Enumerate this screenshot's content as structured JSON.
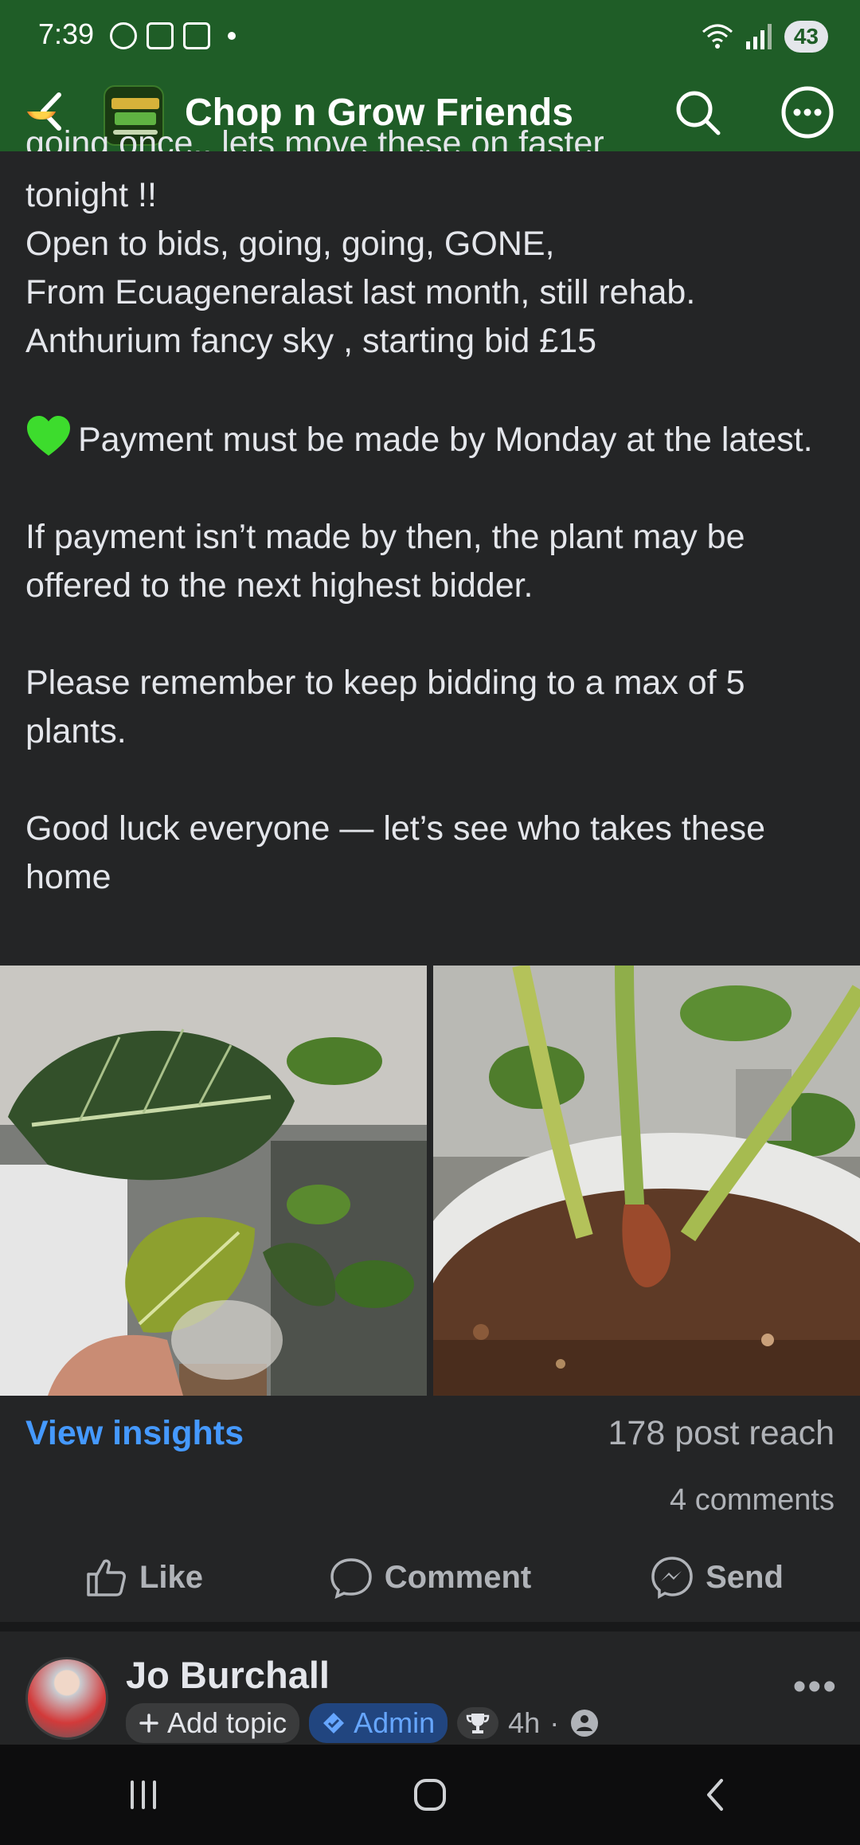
{
  "status_bar": {
    "time": "7:39",
    "battery": "43",
    "icons": [
      "messenger-icon",
      "screenshot-icon",
      "shop-icon",
      "wifi-icon",
      "signal-icon"
    ]
  },
  "header": {
    "group_name": "Chop n Grow Friends",
    "back_icon": "chevron-left-icon",
    "search_icon": "search-icon",
    "more_icon": "more-options-icon"
  },
  "post": {
    "clipped_line": "going once.. lets move these on faster",
    "text_lines": [
      "tonight !!",
      "Open to bids, going, going, GONE,",
      "From Ecuageneralast last month, still rehab.",
      "Anthurium fancy sky , starting bid £15"
    ],
    "payment_line": "Payment must be made by Monday at the latest.",
    "paragraph_2": "If payment isn’t made by then, the plant may be offered to the next highest bidder.",
    "paragraph_3": "Please remember to keep bidding to a max of 5 plants.",
    "paragraph_4": "Good luck everyone — let’s see who takes these home",
    "view_insights": "View insights",
    "reach": "178 post reach",
    "comments": "4 comments",
    "actions": {
      "like": "Like",
      "comment": "Comment",
      "send": "Send"
    }
  },
  "next_post": {
    "author": "Jo Burchall",
    "add_topic": "Add topic",
    "role": "Admin",
    "time": "4h",
    "more": "•••"
  },
  "colors": {
    "header_bg": "#1f5d27",
    "page_bg": "#242526",
    "link_blue": "#4599ff"
  }
}
